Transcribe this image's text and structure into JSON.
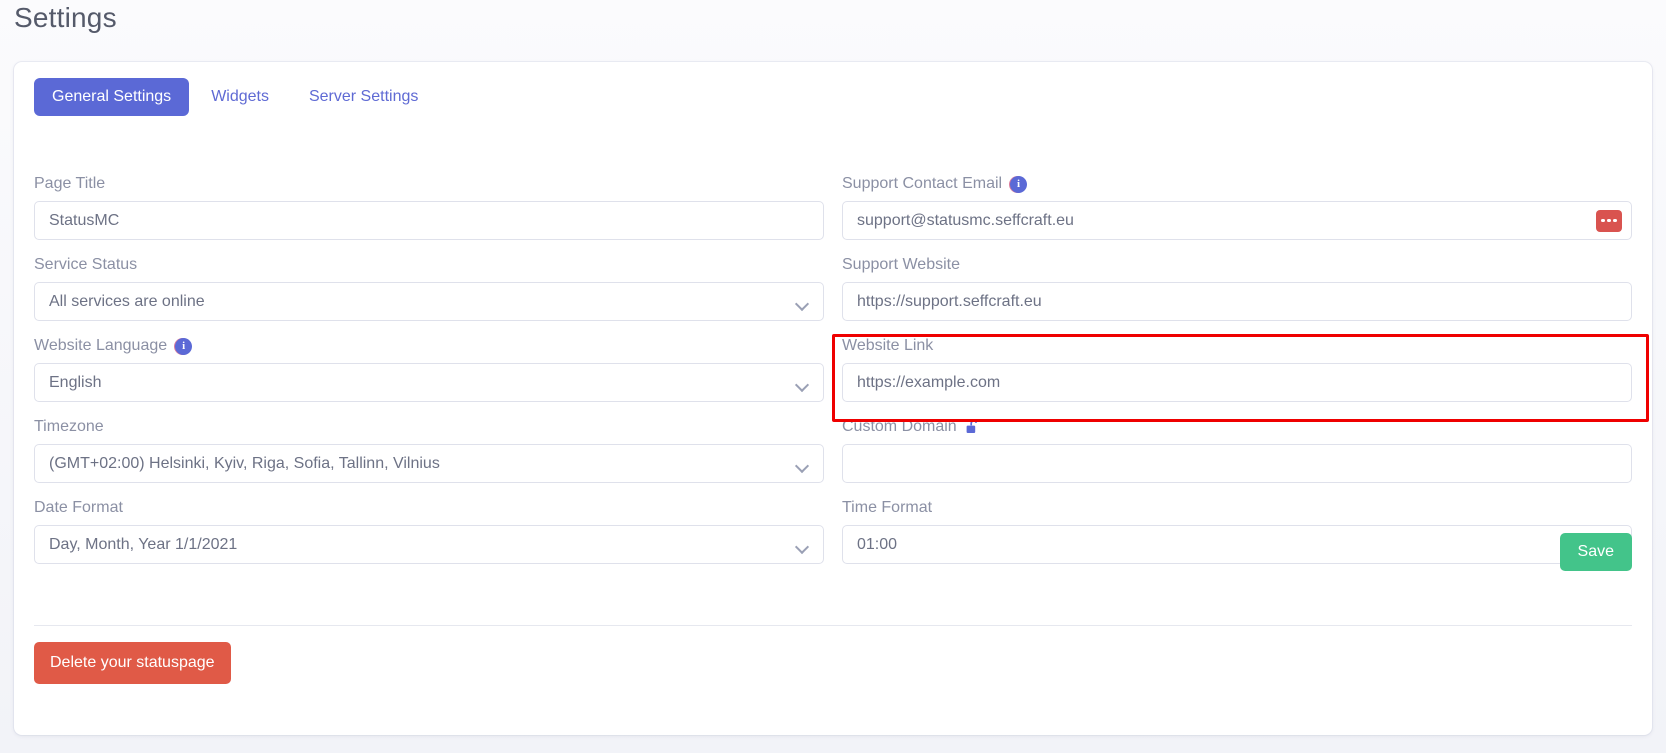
{
  "header": {
    "title": "Settings"
  },
  "tabs": [
    {
      "label": "General Settings",
      "active": true
    },
    {
      "label": "Widgets",
      "active": false
    },
    {
      "label": "Server Settings",
      "active": false
    }
  ],
  "fields": {
    "page_title": {
      "label": "Page Title",
      "value": "StatusMC",
      "type": "text",
      "info": false
    },
    "service_status": {
      "label": "Service Status",
      "value": "All services are online",
      "type": "select",
      "info": false
    },
    "website_language": {
      "label": "Website Language",
      "value": "English",
      "type": "select",
      "info": true
    },
    "timezone": {
      "label": "Timezone",
      "value": "(GMT+02:00) Helsinki, Kyiv, Riga, Sofia, Tallinn, Vilnius",
      "type": "select",
      "info": false
    },
    "date_format": {
      "label": "Date Format",
      "value": "Day, Month, Year 1/1/2021",
      "type": "select",
      "info": false
    },
    "support_email": {
      "label": "Support Contact Email",
      "value": "support@statusmc.seffcraft.eu",
      "type": "text",
      "info": true
    },
    "support_website": {
      "label": "Support Website",
      "value": "https://support.seffcraft.eu",
      "type": "text",
      "info": false
    },
    "website_link": {
      "label": "Website Link",
      "value": "https://example.com",
      "type": "text",
      "info": false
    },
    "custom_domain": {
      "label": "Custom Domain",
      "value": "",
      "type": "text",
      "info": false,
      "lock": "unlock-icon"
    },
    "time_format": {
      "label": "Time Format",
      "value": "01:00",
      "type": "select",
      "info": false
    }
  },
  "icons": {
    "info": "info-icon",
    "unlock": "unlock-icon",
    "ellipsis": "ellipsis-icon",
    "chevron": "chevron-down-icon"
  },
  "actions": {
    "save_label": "Save",
    "delete_label": "Delete your statuspage"
  },
  "colors": {
    "accent": "#5b69d6",
    "save": "#43c48a",
    "delete": "#e05a47",
    "danger_outline": "#ef0000",
    "ellipsis_button": "#d9534f"
  }
}
